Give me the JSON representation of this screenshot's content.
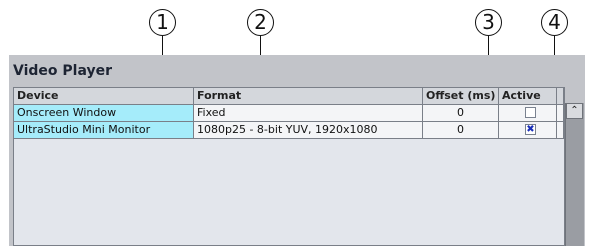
{
  "callouts": [
    "1",
    "2",
    "3",
    "4"
  ],
  "panel": {
    "title": "Video Player"
  },
  "table": {
    "columns": [
      "Device",
      "Format",
      "Offset (ms)",
      "Active"
    ],
    "rows": [
      {
        "device": "Onscreen Window",
        "format": "Fixed",
        "offset": "0",
        "active": false,
        "active_mark": ""
      },
      {
        "device": "UltraStudio Mini Monitor",
        "format": "1080p25 - 8-bit YUV, 1920x1080",
        "offset": "0",
        "active": true,
        "active_mark": "✖"
      }
    ]
  },
  "scrollbar": {
    "up_arrow": "⌃"
  }
}
